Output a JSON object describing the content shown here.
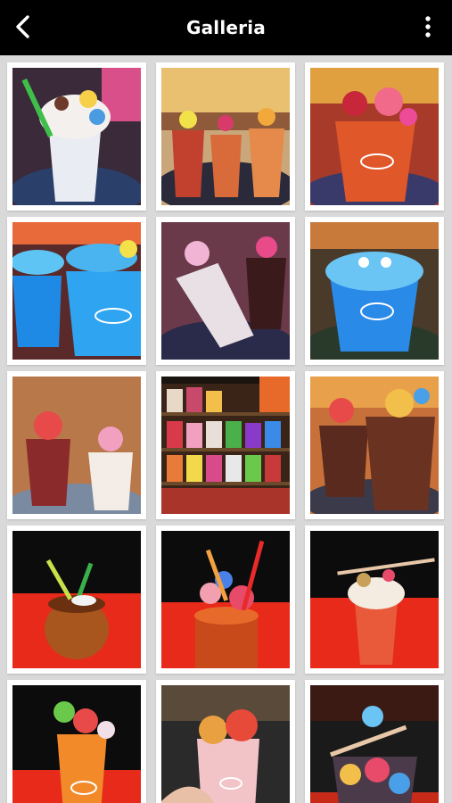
{
  "appbar": {
    "title": "Galleria",
    "back_icon": "chevron-left-icon",
    "menu_icon": "vertical-dots-icon"
  },
  "gallery": {
    "items": [
      {
        "name": "milkshake-whipped-cream",
        "desc": "milkshake"
      },
      {
        "name": "candy-cocktails-shop",
        "desc": "cocktails"
      },
      {
        "name": "red-cocktail-gummies",
        "desc": "red-cocktail"
      },
      {
        "name": "blue-cocktails-capogiro",
        "desc": "blue-cocktails"
      },
      {
        "name": "pink-shake-candy",
        "desc": "pink-shake"
      },
      {
        "name": "blue-monster-cocktail",
        "desc": "blue-cocktail"
      },
      {
        "name": "two-shakes-candy",
        "desc": "two-shakes"
      },
      {
        "name": "candy-jars-shelves",
        "desc": "candy-jars"
      },
      {
        "name": "brown-drinks-candy",
        "desc": "brown-drinks"
      },
      {
        "name": "coconut-cup-drink",
        "desc": "coconut-drink"
      },
      {
        "name": "candy-tiki-cocktail",
        "desc": "tiki-cocktail"
      },
      {
        "name": "cream-top-cocktail",
        "desc": "cream-cocktail"
      },
      {
        "name": "orange-gummy-cocktail",
        "desc": "orange-cocktail"
      },
      {
        "name": "hand-held-cocktail",
        "desc": "hand-cocktail"
      },
      {
        "name": "candy-tower-drink",
        "desc": "candy-tower"
      }
    ]
  },
  "colors": {
    "appbar_bg": "#000000",
    "grid_bg": "#d9d9d9",
    "tile_frame": "#ffffff"
  }
}
